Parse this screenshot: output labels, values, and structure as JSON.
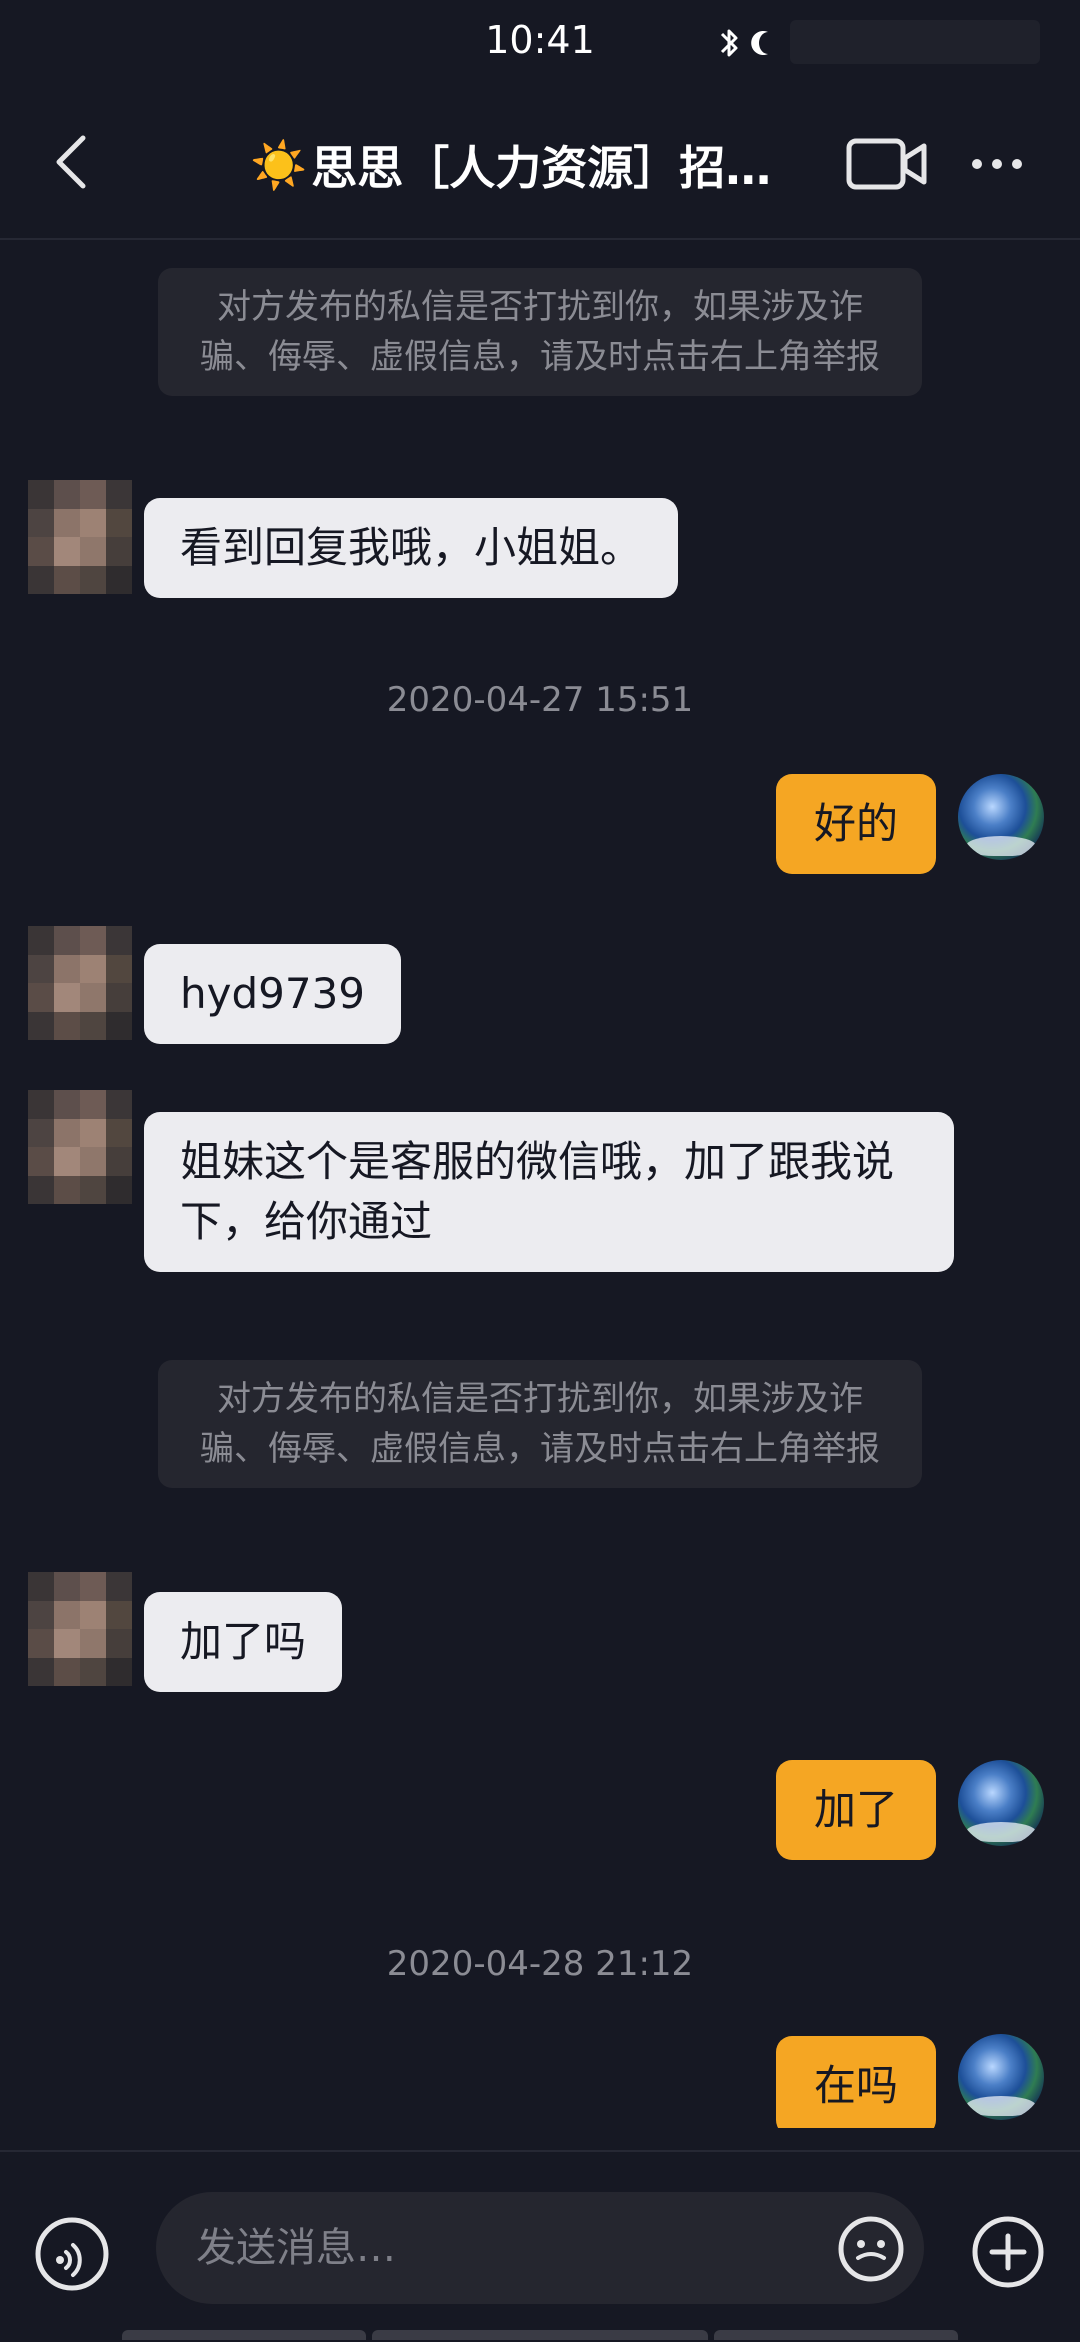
{
  "status_bar": {
    "time": "10:41"
  },
  "header": {
    "title_emoji": "☀️",
    "title": "思思［人力资源］招…",
    "back_icon": "chevron-left-icon",
    "video_icon": "video-camera-icon",
    "more_icon": "more-horizontal-icon"
  },
  "messages": [
    {
      "kind": "notice",
      "text": "对方发布的私信是否打扰到你，如果涉及诈骗、侮辱、虚假信息，请及时点击右上角举报"
    },
    {
      "kind": "incoming",
      "text": "看到回复我哦，小姐姐。"
    },
    {
      "kind": "timestamp",
      "text": "2020-04-27 15:51"
    },
    {
      "kind": "outgoing",
      "text": "好的"
    },
    {
      "kind": "incoming",
      "text": "hyd9739"
    },
    {
      "kind": "incoming",
      "text": "姐妹这个是客服的微信哦，加了跟我说下，给你通过"
    },
    {
      "kind": "notice",
      "text": "对方发布的私信是否打扰到你，如果涉及诈骗、侮辱、虚假信息，请及时点击右上角举报"
    },
    {
      "kind": "incoming",
      "text": "加了吗"
    },
    {
      "kind": "outgoing",
      "text": "加了"
    },
    {
      "kind": "timestamp",
      "text": "2020-04-28 21:12"
    },
    {
      "kind": "outgoing",
      "text": "在吗"
    }
  ],
  "input_bar": {
    "placeholder": "发送消息…",
    "voice_icon": "voice-icon",
    "emoji_icon": "emoji-icon",
    "plus_icon": "plus-icon"
  },
  "colors": {
    "background": "#161823",
    "incoming_bubble": "#ececf0",
    "outgoing_bubble": "#f5a623",
    "notice_bg": "#25262f",
    "muted_text": "#8b8c94"
  }
}
